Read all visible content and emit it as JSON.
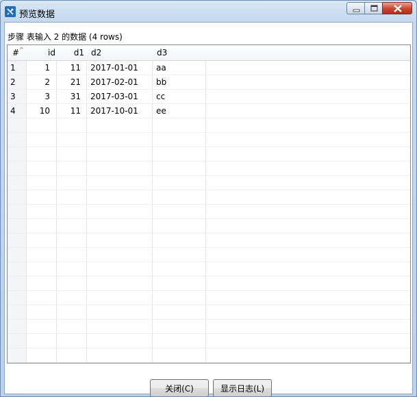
{
  "window": {
    "title": "预览数据",
    "icon": "spoon-app-icon"
  },
  "step_label": "步骤 表输入 2 的数据  (4 rows)",
  "table": {
    "columns": [
      "#",
      "id",
      "d1",
      "d2",
      "d3"
    ],
    "rows": [
      {
        "num": "1",
        "id": "1",
        "d1": "11",
        "d2": "2017-01-01",
        "d3": "aa"
      },
      {
        "num": "2",
        "id": "2",
        "d1": "21",
        "d2": "2017-02-01",
        "d3": "bb"
      },
      {
        "num": "3",
        "id": "3",
        "d1": "31",
        "d2": "2017-03-01",
        "d3": "cc"
      },
      {
        "num": "4",
        "id": "10",
        "d1": "11",
        "d2": "2017-10-01",
        "d3": "ee"
      }
    ]
  },
  "buttons": {
    "close": "关闭(C)",
    "show_log": "显示日志(L)"
  }
}
